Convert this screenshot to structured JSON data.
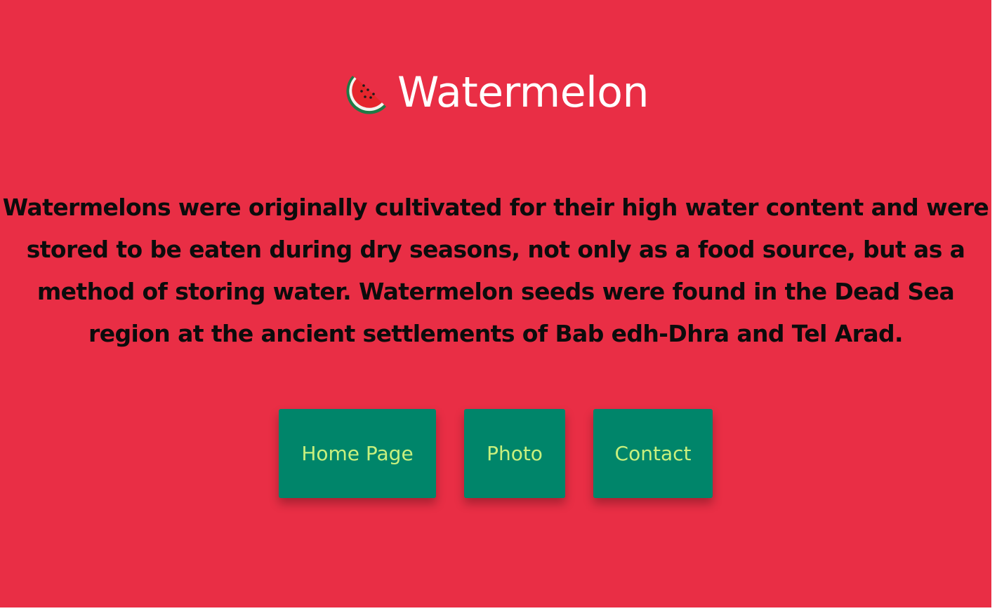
{
  "header": {
    "icon": "watermelon-icon",
    "title": "Watermelon"
  },
  "description": "Watermelons were originally cultivated for their high water content and were stored to be eaten during dry seasons, not only as a food source, but as a method of storing water. Watermelon seeds were found in the Dead Sea region at the ancient settlements of Bab edh-Dhra and Tel Arad.",
  "nav": {
    "buttons": [
      {
        "label": "Home Page"
      },
      {
        "label": "Photo"
      },
      {
        "label": "Contact"
      }
    ]
  },
  "colors": {
    "background": "#e92e45",
    "button": "#00856a",
    "button_text": "#c8f07e",
    "title": "#ffffff",
    "text": "#0c0c0c"
  }
}
